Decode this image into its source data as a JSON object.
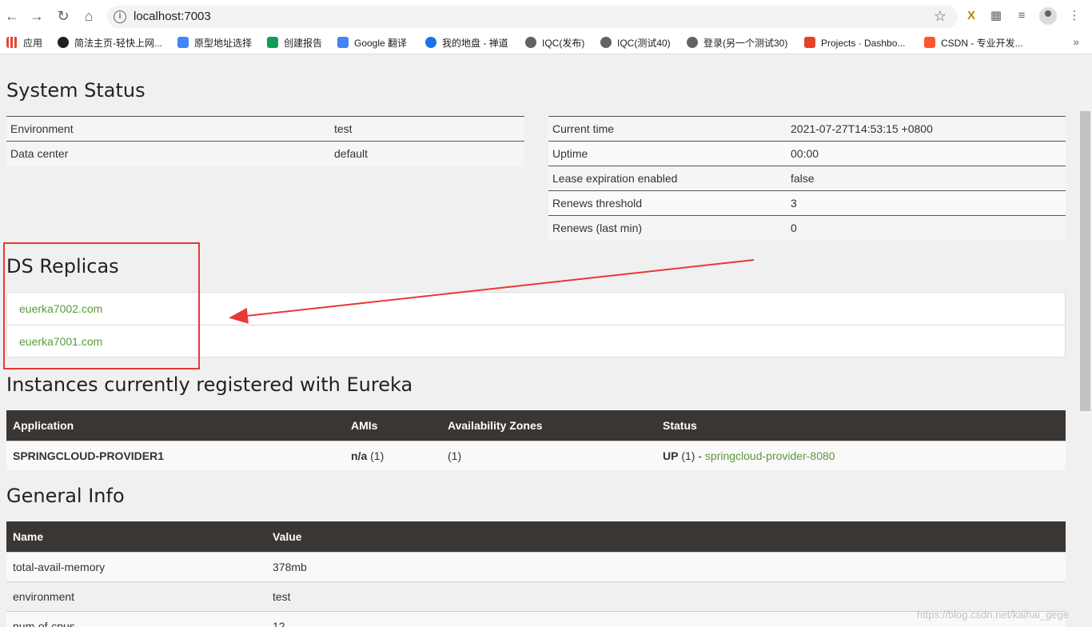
{
  "browser": {
    "url": "localhost:7003",
    "bookmarks": [
      {
        "label": "应用",
        "color": "#ea4335"
      },
      {
        "label": "简法主页-轻快上网...",
        "color": "#202124"
      },
      {
        "label": "原型地址选择",
        "color": "#4285f4"
      },
      {
        "label": "创建报告",
        "color": "#0f9d58"
      },
      {
        "label": "Google 翻译",
        "color": "#4285f4"
      },
      {
        "label": "我的地盘 - 禅道",
        "color": "#1a73e8"
      },
      {
        "label": "IQC(发布)",
        "color": "#5f6368"
      },
      {
        "label": "IQC(测试40)",
        "color": "#5f6368"
      },
      {
        "label": "登录(另一个测试30)",
        "color": "#5f6368"
      },
      {
        "label": "Projects · Dashbo...",
        "color": "#e24329"
      },
      {
        "label": "CSDN - 专业开发...",
        "color": "#fc5531"
      }
    ]
  },
  "page": {
    "system_status_title": "System Status",
    "status_left": [
      {
        "key": "Environment",
        "value": "test"
      },
      {
        "key": "Data center",
        "value": "default"
      }
    ],
    "status_right": [
      {
        "key": "Current time",
        "value": "2021-07-27T14:53:15 +0800"
      },
      {
        "key": "Uptime",
        "value": "00:00"
      },
      {
        "key": "Lease expiration enabled",
        "value": "false"
      },
      {
        "key": "Renews threshold",
        "value": "3"
      },
      {
        "key": "Renews (last min)",
        "value": "0"
      }
    ],
    "replicas_title": "DS Replicas",
    "replicas": [
      "euerka7002.com",
      "euerka7001.com"
    ],
    "instances_title": "Instances currently registered with Eureka",
    "instances_headers": [
      "Application",
      "AMIs",
      "Availability Zones",
      "Status"
    ],
    "instances": [
      {
        "application": "SPRINGCLOUD-PROVIDER1",
        "amis_bold": "n/a",
        "amis_count": " (1)",
        "zones": "(1)",
        "status_bold": "UP",
        "status_count": " (1) - ",
        "status_link": "springcloud-provider-8080"
      }
    ],
    "general_title": "General Info",
    "general_headers": [
      "Name",
      "Value"
    ],
    "general": [
      {
        "name": "total-avail-memory",
        "value": "378mb"
      },
      {
        "name": "environment",
        "value": "test"
      },
      {
        "name": "num-of-cpus",
        "value": "12"
      }
    ],
    "watermark": "https://blog.csdn.net/kaihai_gege"
  },
  "colors": {
    "header_bg": "#3a3633",
    "link": "#5a9a3a",
    "annotation": "#e53935"
  }
}
